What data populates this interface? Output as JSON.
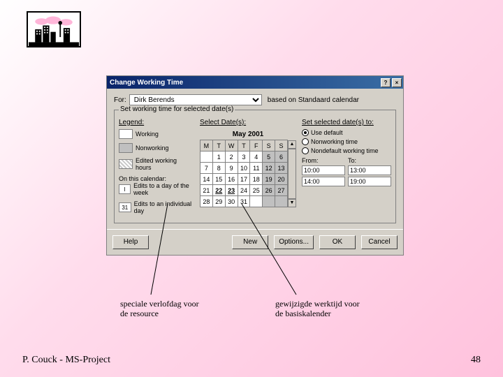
{
  "dialog": {
    "title": "Change Working Time",
    "for_label": "For:",
    "for_value": "Dirk Berends",
    "based_on": "based on Standaard calendar",
    "set_label": "Set working time for selected date(s)"
  },
  "legend": {
    "header": "Legend:",
    "working": "Working",
    "nonworking": "Nonworking",
    "edited": "Edited working hours",
    "on_this": "On this calendar:",
    "edits_day": "Edits to a day of the week",
    "edits_indiv": "Edits to an individual day",
    "day_i": "I",
    "day_31": "31"
  },
  "calendar": {
    "select_label": "Select Date(s):",
    "month": "May 2001",
    "dow": [
      "M",
      "T",
      "W",
      "T",
      "F",
      "S",
      "S"
    ],
    "rows": [
      [
        "",
        "1",
        "2",
        "3",
        "4",
        "5",
        "6"
      ],
      [
        "7",
        "8",
        "9",
        "10",
        "11",
        "12",
        "13"
      ],
      [
        "14",
        "15",
        "16",
        "17",
        "18",
        "19",
        "20"
      ],
      [
        "21",
        "22",
        "23",
        "24",
        "25",
        "26",
        "27"
      ],
      [
        "28",
        "29",
        "30",
        "31",
        "",
        "",
        ""
      ]
    ],
    "weekend_cols": [
      5,
      6
    ],
    "edited_cells": [
      [
        3,
        1
      ],
      [
        3,
        2
      ]
    ]
  },
  "settings": {
    "header": "Set selected date(s) to:",
    "use_default": "Use default",
    "nonworking": "Nonworking time",
    "nondefault": "Nondefault working time",
    "from_label": "From:",
    "to_label": "To:",
    "from1": "10:00",
    "to1": "13:00",
    "from2": "14:00",
    "to2": "19:00"
  },
  "buttons": {
    "help": "Help",
    "new": "New",
    "options": "Options...",
    "ok": "OK",
    "cancel": "Cancel"
  },
  "annotations": {
    "left_l1": "speciale verlofdag voor",
    "left_l2": "de resource",
    "right_l1": "gewijzigde werktijd voor",
    "right_l2": "de basiskalender"
  },
  "footer": {
    "left": "P. Couck - MS-Project",
    "right": "48"
  }
}
